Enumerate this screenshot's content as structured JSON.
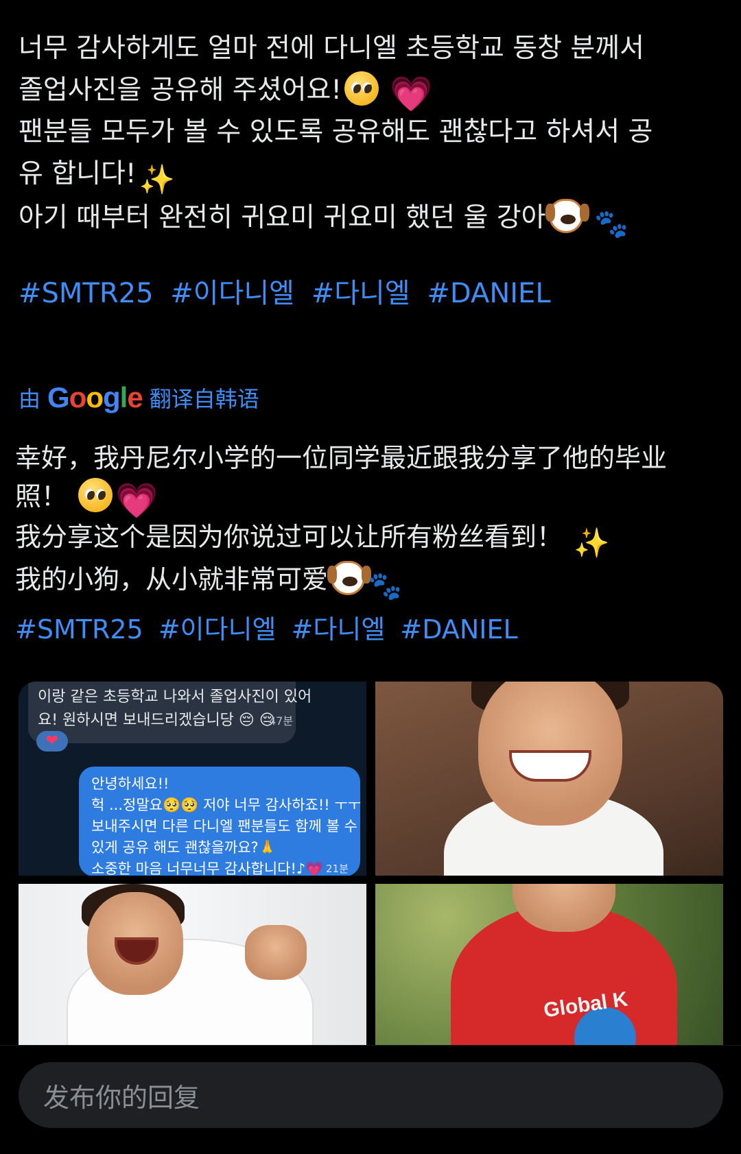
{
  "tweet": {
    "lines": [
      "너무 감사하게도 얼마 전에 다니엘 초등학교 동창 분께서",
      "졸업사진을 공유해 주셨어요!",
      "팬분들 모두가 볼 수 있도록 공유해도 괜찮다고 하셔서 공",
      "유 합니다!",
      "아기 때부터 완전히 귀요미 귀요미 했던 울 강아"
    ],
    "hashtags": [
      "#SMTR25",
      "#이다니엘",
      "#다니엘",
      "#DANIEL"
    ]
  },
  "translation": {
    "prefix": "由",
    "google": [
      "G",
      "o",
      "o",
      "g",
      "l",
      "e"
    ],
    "suffix": "翻译自韩语",
    "lines": [
      "幸好，我丹尼尔小学的一位同学最近跟我分享了他的毕业",
      "照！",
      "我分享这个是因为你说过可以让所有粉丝看到！",
      "我的小狗，从小就非常可爱"
    ],
    "hashtags": [
      "#SMTR25",
      "#이다니엘",
      "#다니엘",
      "#DANIEL"
    ]
  },
  "media": {
    "chat": {
      "top_lines": [
        "이랑 같은 초등학교 나와서 졸업사진이 있어",
        "요! 원하시면 보내드리겠습니당 😔 😔"
      ],
      "top_time": "47분",
      "heart": "❤",
      "bubble_lines": [
        "안녕하세요!!",
        "헉 ...정말요🥺🥺 저야 너무 감사하죠!! ㅜㅜ",
        "보내주시면 다른 다니엘 팬분들도 함께 볼 수",
        "있게 공유 해도 괜찮을까요?🙏",
        "소중한 마음 너무너무 감사합니다!♪💗"
      ],
      "bubble_time": "21분"
    },
    "shirt_logo": "Global K"
  },
  "reply": {
    "placeholder": "发布你的回复"
  },
  "emoji": {
    "pleading": "pleading-face-icon",
    "heart": "💗",
    "sparkles": "✨",
    "dog": "dog-face-icon",
    "paws": "🐾"
  }
}
